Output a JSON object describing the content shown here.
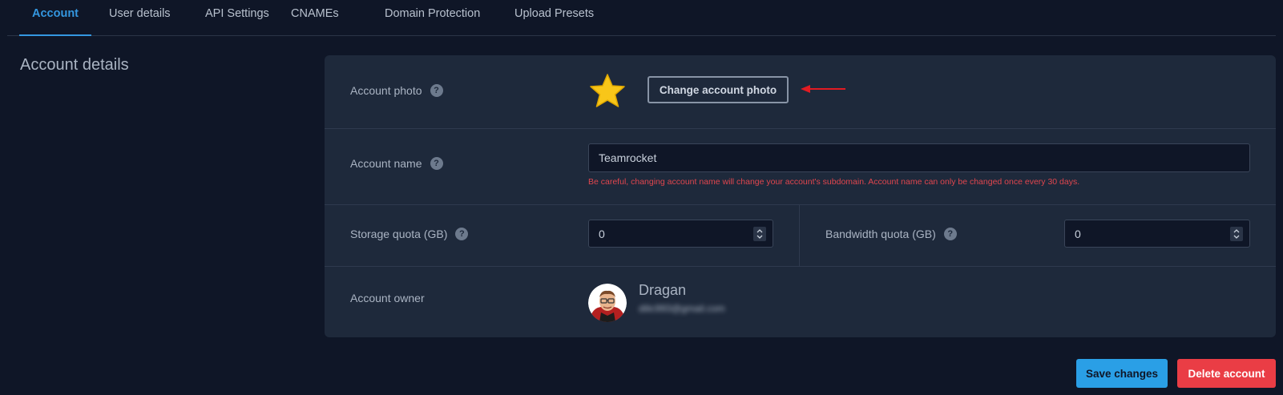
{
  "tabs": [
    "Account",
    "User details",
    "API Settings",
    "CNAMEs",
    "Domain Protection",
    "Upload Presets"
  ],
  "section_title": "Account details",
  "account_photo": {
    "label": "Account photo",
    "help": "?",
    "button": "Change account photo"
  },
  "account_name": {
    "label": "Account name",
    "help": "?",
    "value": "Teamrocket",
    "warning": "Be careful, changing account name will change your account's subdomain. Account name can only be changed once every 30 days."
  },
  "storage_quota": {
    "label": "Storage quota (GB)",
    "help": "?",
    "value": "0"
  },
  "bandwidth_quota": {
    "label": "Bandwidth quota (GB)",
    "help": "?",
    "value": "0"
  },
  "owner": {
    "label": "Account owner",
    "name": "Dragan",
    "email": "dilic993@gmail.com"
  },
  "actions": {
    "save": "Save changes",
    "delete": "Delete account"
  },
  "colors": {
    "accent": "#3497e0",
    "danger": "#ea3d45",
    "warning_text": "#e0464e",
    "star": "#f8c619"
  },
  "icons": {
    "photo": "star-icon",
    "arrow": "arrow-left-icon",
    "spinner": "spinner-icon"
  }
}
